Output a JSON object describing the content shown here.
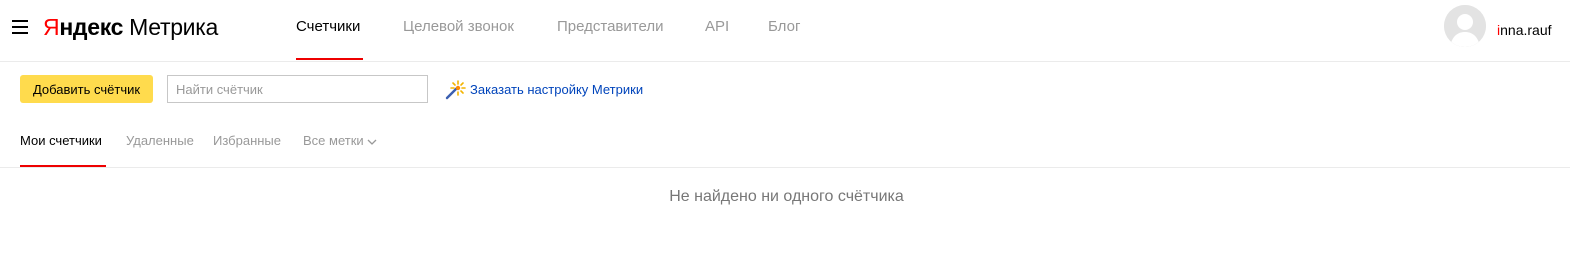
{
  "header": {
    "logo": {
      "brand_first": "Я",
      "brand_rest": "ндекс",
      "product": "Метрика"
    },
    "nav": [
      {
        "label": "Счетчики",
        "active": true
      },
      {
        "label": "Целевой звонок",
        "active": false
      },
      {
        "label": "Представители",
        "active": false
      },
      {
        "label": "API",
        "active": false
      },
      {
        "label": "Блог",
        "active": false
      }
    ],
    "user": {
      "name_first": "i",
      "name_rest": "nna.rauf"
    }
  },
  "toolbar": {
    "add_counter_label": "Добавить счётчик",
    "search": {
      "value": "",
      "placeholder": "Найти счётчик"
    },
    "order_setup_label": "Заказать настройку Метрики"
  },
  "tabs": [
    {
      "label": "Мои счетчики",
      "active": true
    },
    {
      "label": "Удаленные",
      "active": false
    },
    {
      "label": "Избранные",
      "active": false
    },
    {
      "label": "Все метки",
      "active": false,
      "has_dropdown": true
    }
  ],
  "empty_state": "Не найдено ни одного счётчика",
  "colors": {
    "brand_red": "#ff0000",
    "accent_underline": "#ee0000",
    "button_yellow": "#ffdb4d",
    "link_blue": "#0044bb"
  },
  "icons": {
    "menu": "hamburger-icon",
    "avatar": "user-avatar-icon",
    "order_setup": "magic-wand-icon",
    "dropdown": "chevron-down-icon"
  }
}
